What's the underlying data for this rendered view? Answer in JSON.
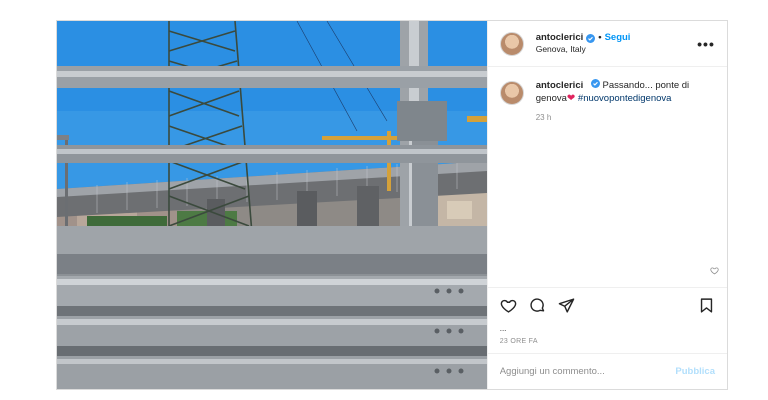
{
  "post": {
    "author": {
      "username": "antoclerici",
      "verified": true,
      "follow_label": "Segui",
      "separator": "•",
      "location": "Genova, Italy",
      "more_label": "•••"
    },
    "caption": {
      "username": "antoclerici",
      "text": "Passando... ponte di genova",
      "emoji": "❤",
      "hashtag": "#nuovopontedigenova",
      "time": "23 h"
    },
    "likes_text": "...",
    "timestamp": "23 ORE FA",
    "comment": {
      "placeholder": "Aggiungi un commento...",
      "publish_label": "Pubblica"
    },
    "colors": {
      "accent": "#0095f6",
      "publish_disabled": "#b2dffc",
      "sky": "#2a8be0"
    },
    "icons": [
      "verified-badge-icon",
      "more-options-icon",
      "heart-icon",
      "comment-icon",
      "share-icon",
      "bookmark-icon"
    ]
  }
}
